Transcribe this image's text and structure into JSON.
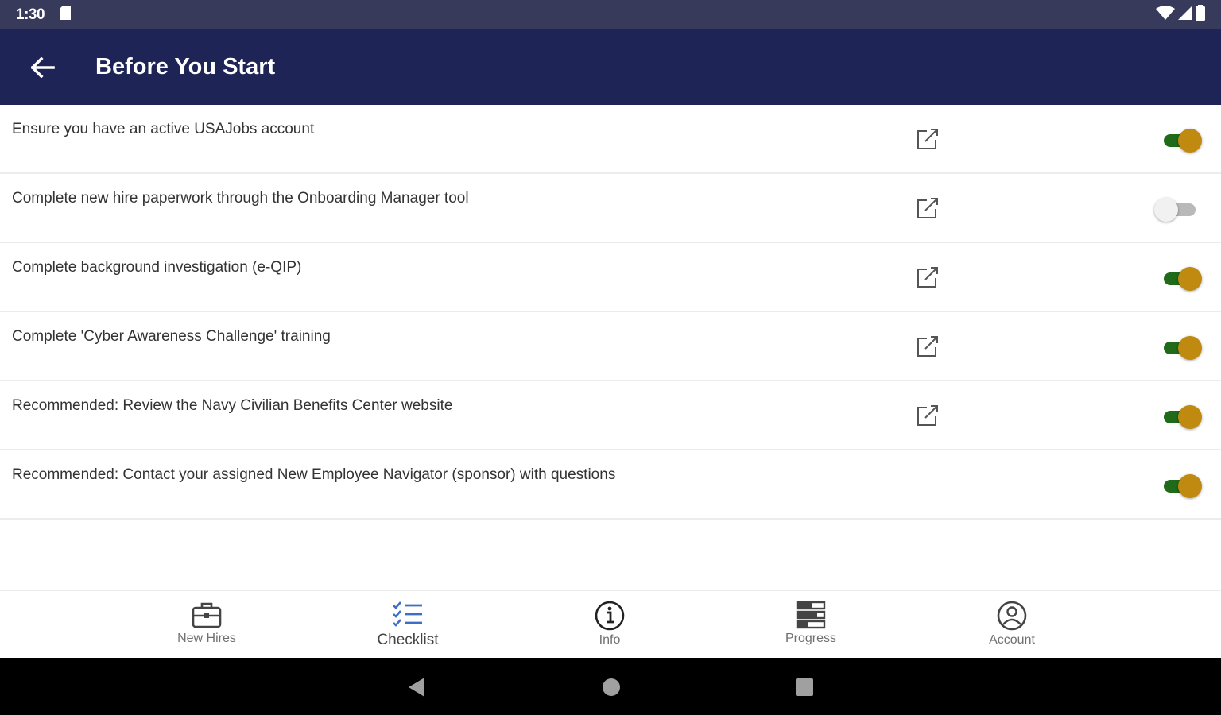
{
  "status_bar": {
    "time": "1:30"
  },
  "app_bar": {
    "title": "Before You Start"
  },
  "checklist": [
    {
      "label": "Ensure you have an active USAJobs account",
      "has_link": true,
      "checked": true
    },
    {
      "label": "Complete new hire paperwork through the Onboarding Manager tool",
      "has_link": true,
      "checked": false
    },
    {
      "label": "Complete background investigation (e-QIP)",
      "has_link": true,
      "checked": true
    },
    {
      "label": "Complete 'Cyber Awareness Challenge' training",
      "has_link": true,
      "checked": true
    },
    {
      "label": "Recommended: Review the Navy Civilian Benefits Center website",
      "has_link": true,
      "checked": true
    },
    {
      "label": "Recommended: Contact your assigned New Employee Navigator (sponsor) with questions",
      "has_link": false,
      "checked": true
    }
  ],
  "bottom_nav": [
    {
      "label": "New Hires",
      "icon": "briefcase-icon"
    },
    {
      "label": "Checklist",
      "icon": "checklist-icon",
      "active": true
    },
    {
      "label": "Info",
      "icon": "info-icon"
    },
    {
      "label": "Progress",
      "icon": "progress-icon"
    },
    {
      "label": "Account",
      "icon": "account-icon"
    }
  ],
  "colors": {
    "status_bar": "#383a5c",
    "app_bar": "#1e2455",
    "toggle_track_on": "#1f6b1a",
    "toggle_thumb_on": "#c08a10",
    "nav_active": "#3d6fc4"
  }
}
